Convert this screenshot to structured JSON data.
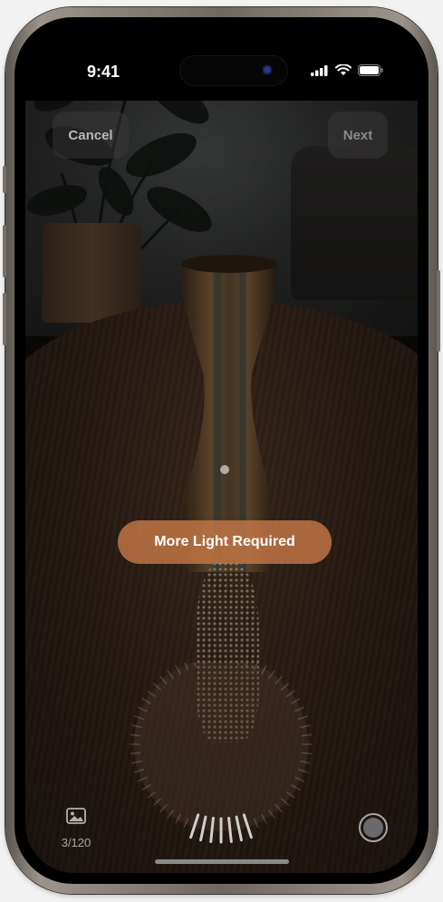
{
  "status_bar": {
    "time": "9:41",
    "signal_icon": "cellular-signal-icon",
    "wifi_icon": "wifi-icon",
    "battery_icon": "battery-icon"
  },
  "toolbar": {
    "cancel_label": "Cancel",
    "next_label": "Next"
  },
  "message": {
    "text": "More Light Required"
  },
  "capture": {
    "count": "3/120",
    "gallery_icon": "photo-gallery-icon",
    "shutter_icon": "shutter-button-icon"
  },
  "colors": {
    "pill": "#c4784699",
    "button_bg": "#3c3c3c"
  }
}
